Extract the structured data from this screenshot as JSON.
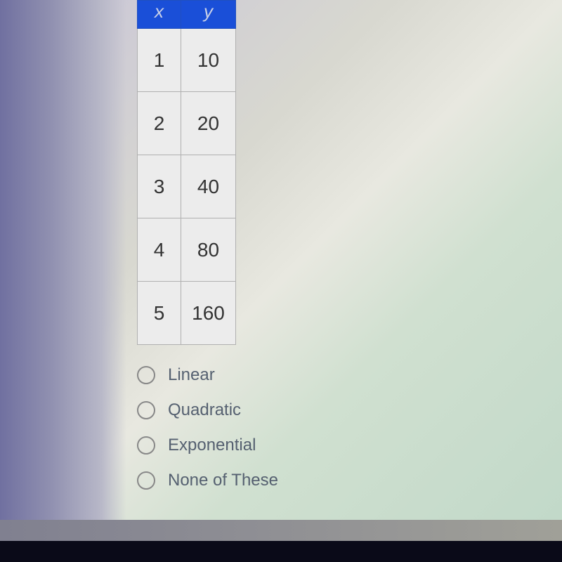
{
  "chart_data": {
    "type": "table",
    "columns": [
      "x",
      "y"
    ],
    "rows": [
      [
        1,
        10
      ],
      [
        2,
        20
      ],
      [
        3,
        40
      ],
      [
        4,
        80
      ],
      [
        5,
        160
      ]
    ]
  },
  "table": {
    "header_x": "x",
    "header_y": "y",
    "r0c0": "1",
    "r0c1": "10",
    "r1c0": "2",
    "r1c1": "20",
    "r2c0": "3",
    "r2c1": "40",
    "r3c0": "4",
    "r3c1": "80",
    "r4c0": "5",
    "r4c1": "160"
  },
  "options": {
    "opt0": "Linear",
    "opt1": "Quadratic",
    "opt2": "Exponential",
    "opt3": "None of These"
  }
}
